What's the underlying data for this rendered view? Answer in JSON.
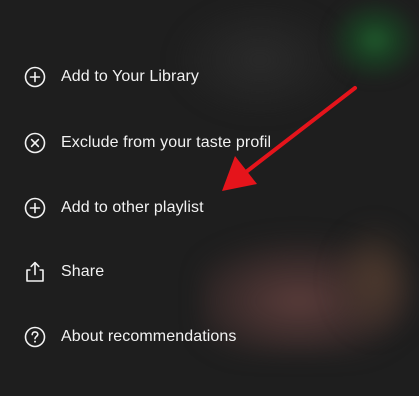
{
  "menu": {
    "items": [
      {
        "label": "Add to Your Library",
        "icon": "plus-circle-icon"
      },
      {
        "label": "Exclude from your taste profil",
        "icon": "x-circle-icon"
      },
      {
        "label": "Add to other playlist",
        "icon": "plus-circle-icon"
      },
      {
        "label": "Share",
        "icon": "share-icon"
      },
      {
        "label": "About recommendations",
        "icon": "question-circle-icon"
      }
    ]
  },
  "annotation": {
    "arrow_color": "#e5141b"
  },
  "colors": {
    "background": "#1e1e1e",
    "text": "#f2f2f2"
  }
}
